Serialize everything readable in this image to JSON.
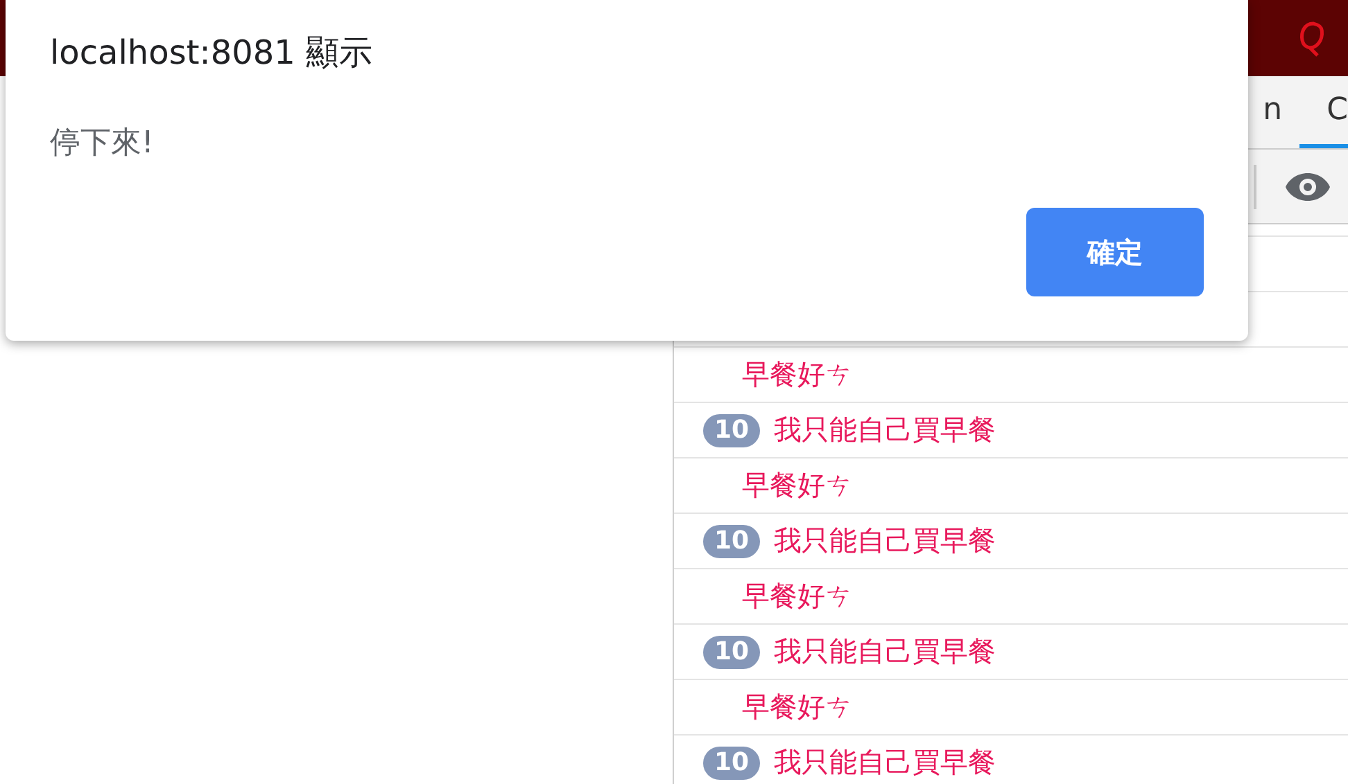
{
  "dialog": {
    "title": "localhost:8081 顯示",
    "message": "停下來!",
    "button": "確定"
  },
  "devtools": {
    "tabs": [
      {
        "label": "n",
        "selected": false
      },
      {
        "label": "C",
        "selected": true
      }
    ],
    "console": [
      {
        "text": "早餐好ㄘ"
      },
      {
        "count": "10",
        "text": "我只能自己買早餐"
      },
      {
        "text": "早餐好ㄘ"
      },
      {
        "count": "10",
        "text": "我只能自己買早餐"
      },
      {
        "text": "早餐好ㄘ"
      },
      {
        "count": "10",
        "text": "我只能自己買早餐"
      },
      {
        "text": "早餐好ㄘ"
      },
      {
        "count": "10",
        "text": "我只能自己買早餐"
      }
    ]
  }
}
